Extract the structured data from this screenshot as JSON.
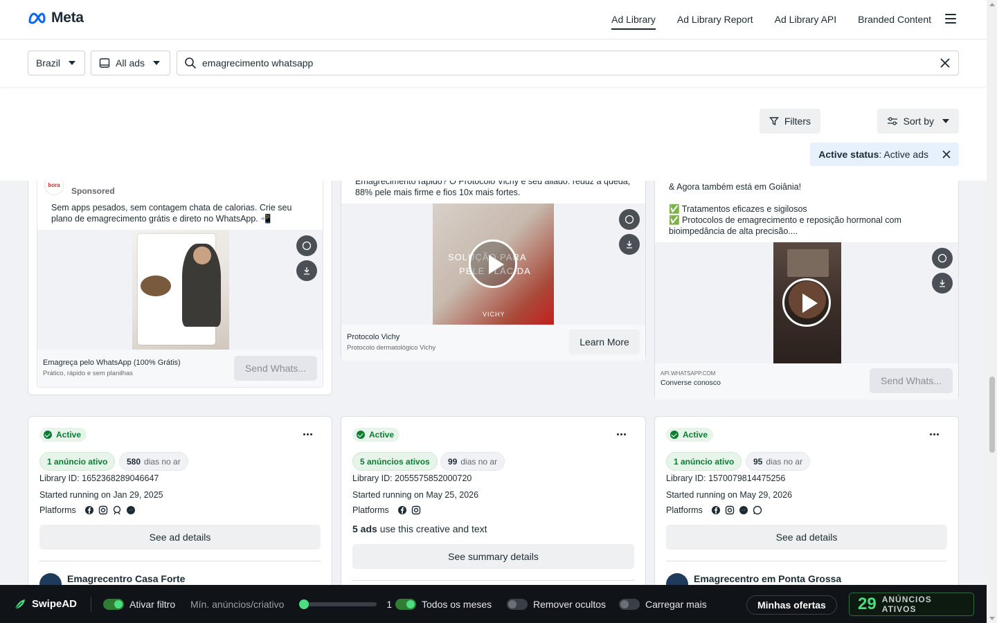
{
  "header": {
    "brand": "Meta",
    "nav": [
      "Ad Library",
      "Ad Library Report",
      "Ad Library API",
      "Branded Content"
    ]
  },
  "search": {
    "country": "Brazil",
    "ad_type": "All ads",
    "query": "emagrecimento whatsapp"
  },
  "filters": {
    "filters_label": "Filters",
    "sort_label": "Sort by",
    "status_key": "Active status",
    "status_value": ": Active ads"
  },
  "ads": [
    {
      "sponsored": "Sponsored",
      "body": "Sem apps pesados, sem contagem chata de calorias. Crie seu plano de emagrecimento grátis e direto no WhatsApp. 📲",
      "cta_title": "Emagreça pelo WhatsApp (100% Grátis)",
      "cta_sub": "Prático, rápido e sem planilhas",
      "cta_button": "Send Whats..."
    },
    {
      "body": "Emagrecimento rápido? O Protocolo Vichy é seu aliado: reduz a queda, 88% pele mais firme e fios 10x mais fortes.",
      "overlay_line1": "SOLUÇÃO PARA",
      "overlay_line2": "PELE FLÁCIDA",
      "overlay_brand": "VICHY",
      "cta_title": "Protocolo Vichy",
      "cta_sub": "Protocolo dermatológico Vichy",
      "cta_button": "Learn More"
    },
    {
      "body_lines": [
        "& Agora também está em Goiânia!",
        "✅ Tratamentos eficazes e sigilosos",
        "✅ Protocolos de emagrecimento e reposição hormonal com bioimpedância de alta precisão...."
      ],
      "cta_domain": "API.WHATSAPP.COM",
      "cta_title": "Converse conosco",
      "cta_button": "Send Whats..."
    }
  ],
  "details": [
    {
      "status": "Active",
      "active_count": "1 anúncio ativo",
      "days_num": "580",
      "days_label": "dias no ar",
      "library_id": "Library ID: 1652368289046647",
      "started": "Started running on Jan 29, 2025",
      "platforms_label": "Platforms",
      "button": "See ad details",
      "advertiser": "Emagrecentro Casa Forte"
    },
    {
      "status": "Active",
      "active_count": "5 anúncios ativos",
      "days_num": "99",
      "days_label": "dias no ar",
      "library_id": "Library ID: 2055575852000720",
      "started": "Started running on May 25, 2026",
      "platforms_label": "Platforms",
      "creative_count": "5 ads",
      "creative_text": " use this creative and text",
      "button": "See summary details"
    },
    {
      "status": "Active",
      "active_count": "1 anúncio ativo",
      "days_num": "95",
      "days_label": "dias no ar",
      "library_id": "Library ID: 1570079814475256",
      "started": "Started running on May 29, 2026",
      "platforms_label": "Platforms",
      "button": "See ad details",
      "advertiser": "Emagrecentro em Ponta Grossa"
    }
  ],
  "swipead": {
    "brand": "SwipeAD",
    "filter_label": "Ativar filtro",
    "min_label": "Mín. anúncios/criativo",
    "min_value": "1",
    "months_label": "Todos os meses",
    "hidden_label": "Remover ocultos",
    "load_label": "Carregar mais",
    "offers_label": "Minhas ofertas",
    "count": "29",
    "count_label": "ANÚNCIOS ATIVOS"
  },
  "colors": {
    "accent": "#0a7d32",
    "brand_blue": "#0866ff",
    "swipe_green": "#4ade80"
  }
}
